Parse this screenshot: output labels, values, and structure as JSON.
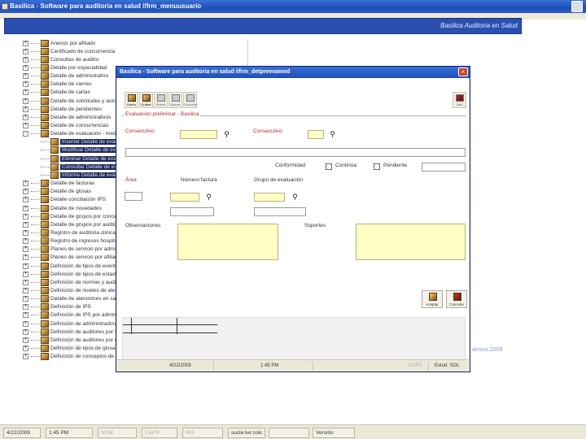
{
  "main_window": {
    "title": "Basilica - Software para auditoria en salud //frm_menuusuario",
    "banner": "Basilica   Auditoria   en   Salud",
    "footer_text": "amuro 2009"
  },
  "tree": {
    "items": [
      {
        "label": "Anexos por afiliado",
        "child": false
      },
      {
        "label": "Certificado de concurrencia",
        "child": false
      },
      {
        "label": "Consultas de auditor",
        "child": false
      },
      {
        "label": "Detalle por especialidad",
        "child": false
      },
      {
        "label": "Detalle de administrativo",
        "child": false
      },
      {
        "label": "Detalle de cierres",
        "child": false
      },
      {
        "label": "Detalle de cartas",
        "child": false
      },
      {
        "label": "Detalle de solicitudes y autorizaciones",
        "child": false
      },
      {
        "label": "Detalle de pendientes",
        "child": false
      },
      {
        "label": "Detalle de administrativos",
        "child": false
      },
      {
        "label": "Detalle de concurrencias",
        "child": false
      },
      {
        "label": "Detalle de evaluación - medico",
        "child": false
      },
      {
        "label": "Insertar Detalle de evaluación",
        "child": true
      },
      {
        "label": "Modificar Detalle de evaluación",
        "child": true
      },
      {
        "label": "Eliminar Detalle de evaluación",
        "child": true
      },
      {
        "label": "Consultar Detalle de evaluación",
        "child": true
      },
      {
        "label": "Informe Detalle de evaluación",
        "child": true
      },
      {
        "label": "Detalle de facturas",
        "child": false
      },
      {
        "label": "Detalle de glosas",
        "child": false
      },
      {
        "label": "Detalle conciliación IPS",
        "child": false
      },
      {
        "label": "Detalle de novedades",
        "child": false
      },
      {
        "label": "Detalle de grupos por concepto",
        "child": false
      },
      {
        "label": "Detalle de grupos por auditor",
        "child": false
      },
      {
        "label": "Registro de auditoria clinica",
        "child": false
      },
      {
        "label": "Registro de ingresos hospitalarios",
        "child": false
      },
      {
        "label": "Planes de servicio por administradora",
        "child": false
      },
      {
        "label": "Planes de servicio por afiliado",
        "child": false
      },
      {
        "label": "Definición de tipos de evento",
        "child": false
      },
      {
        "label": "Definición de tipos de estado",
        "child": false
      },
      {
        "label": "Definición de normas y auditorias",
        "child": false
      },
      {
        "label": "Definición de niveles de atención",
        "child": false
      },
      {
        "label": "Detalle de atenciones en salud",
        "child": false
      },
      {
        "label": "Definición de IPS",
        "child": false
      },
      {
        "label": "Definición de IPS por administradora",
        "child": false
      },
      {
        "label": "Definición de administradoras",
        "child": false
      },
      {
        "label": "Definición de auditores por IPS",
        "child": false
      },
      {
        "label": "Definición de auditores por grupo",
        "child": false
      },
      {
        "label": "Definición de tipos de glosa",
        "child": false
      },
      {
        "label": "Definición de conceptos de glosa",
        "child": false
      }
    ]
  },
  "statusbar": {
    "date": "4/22/2009",
    "time": "1:45 PM",
    "num": "NUM",
    "caps": "CAPS",
    "ins": "INS",
    "user": "sucla lwr.colc",
    "blank": "",
    "version": "Versión"
  },
  "dialog": {
    "title": "Basilica - Software para auditoria en salud //frm_detpreevamed",
    "toolbar": [
      {
        "label": "Nuevo",
        "active": true
      },
      {
        "label": "Grabar",
        "active": true
      },
      {
        "label": "Borrar",
        "active": false
      },
      {
        "label": "Buscar",
        "active": false
      },
      {
        "label": "Cancelar",
        "active": false
      }
    ],
    "exit_label": "Salir",
    "section_label": "Evaluación preliminar - Basilica",
    "fields": {
      "consecutivo_label": "Consecutivo",
      "consecutivo_value": "",
      "consecutivo2_label": "Consecutivo",
      "consecutivo2_value": "",
      "description_value": "",
      "conformidad_label": "Conformidad",
      "continua_label": "Continúa",
      "pendiente_label": "Pendiente",
      "pendiente_value": "",
      "area_label": "Área",
      "area_value": "",
      "numero_factura_label": "Número factura",
      "numero_factura_value": "",
      "numero_factura_extra": "",
      "grupo_evaluacion_label": "Grupo de evaluación",
      "grupo_evaluacion_value": "",
      "grupo_evaluacion_extra": "",
      "observaciones_label": "Observaciones",
      "observaciones_value": "",
      "soportes_label": "Soportes",
      "soportes_value": ""
    },
    "buttons": {
      "aceptar": "Aceptar",
      "cancelar": "Cancelar"
    },
    "status": {
      "date": "4/22/2009",
      "time": "1:45 PM",
      "caps": "CAPS",
      "app": "Estud. SOL"
    }
  }
}
